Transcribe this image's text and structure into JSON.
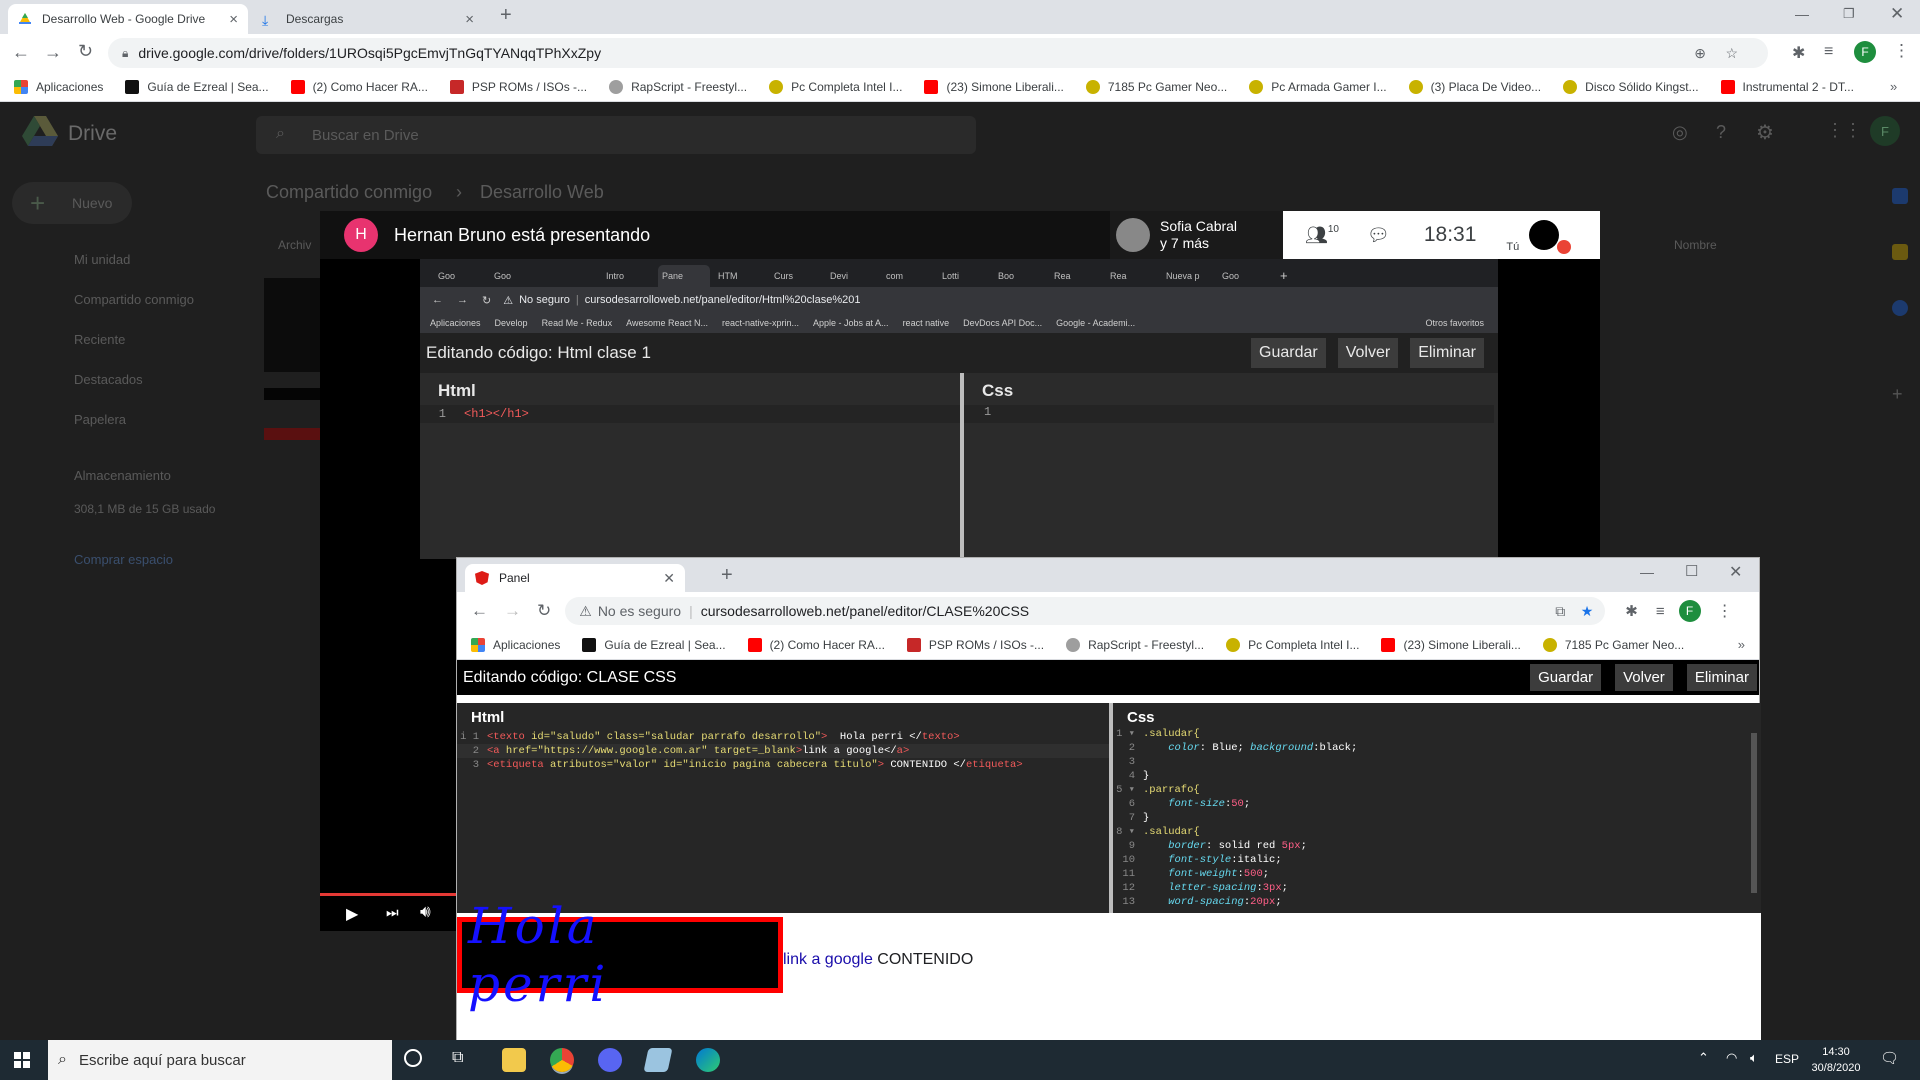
{
  "outer_tabs": [
    {
      "label": "Desarrollo Web - Google Drive"
    },
    {
      "label": "Descargas"
    }
  ],
  "outer_url": "drive.google.com/drive/folders/1UROsqi5PgcEmvjTnGqTYANqqTPhXxZpy",
  "outer_bookmarks": [
    {
      "label": "Aplicaciones",
      "color": "#ea4335"
    },
    {
      "label": "Guía de Ezreal | Sea...",
      "color": "#111111"
    },
    {
      "label": "(2) Como Hacer RA...",
      "color": "#ff0000"
    },
    {
      "label": "PSP ROMs / ISOs -...",
      "color": "#c62828"
    },
    {
      "label": "RapScript - Freestyl...",
      "color": "#9e9e9e"
    },
    {
      "label": "Pc Completa Intel I...",
      "color": "#c8b200"
    },
    {
      "label": "(23) Simone Liberali...",
      "color": "#ff0000"
    },
    {
      "label": "7185 Pc Gamer Neo...",
      "color": "#c8b200"
    },
    {
      "label": "Pc Armada Gamer I...",
      "color": "#c8b200"
    },
    {
      "label": "(3) Placa De Video...",
      "color": "#c8b200"
    },
    {
      "label": "Disco Sólido Kingst...",
      "color": "#c8b200"
    },
    {
      "label": "Instrumental 2 - DT...",
      "color": "#ff0000"
    }
  ],
  "drive": {
    "brand": "Drive",
    "search_placeholder": "Buscar en Drive",
    "new_label": "Nuevo",
    "breadcrumb_root": "Compartido conmigo",
    "breadcrumb_current": "Desarrollo Web",
    "nav": [
      "Mi unidad",
      "Compartido conmigo",
      "Reciente",
      "Destacados",
      "Papelera"
    ],
    "storage_label": "Almacenamiento",
    "storage_used": "308,1 MB de 15 GB usado",
    "buy_storage": "Comprar espacio",
    "col_archivo": "Archiv",
    "col_nombre": "Nombre"
  },
  "meet": {
    "presenter_initial": "H",
    "presenter_text": "Hernan Bruno está presentando",
    "participant_name": "Sofia Cabral",
    "participant_more": "y 7 más",
    "participants_count": "10",
    "time": "18:31",
    "self_label": "Tú"
  },
  "inner": {
    "tabs": [
      "Goo",
      "Goo",
      "",
      "Intro",
      "Pane",
      "HTM",
      "Curs",
      "Devi",
      "com",
      "Lotti",
      "Boo",
      "Rea",
      "Rea",
      "Nueva p",
      "Goo"
    ],
    "not_secure": "No seguro",
    "url": "cursodesarrolloweb.net/panel/editor/Html%20clase%201",
    "bookmarks": [
      "Aplicaciones",
      "Develop",
      "Read Me - Redux",
      "Awesome React N...",
      "react-native-xprin...",
      "Apple - Jobs at A...",
      "react native",
      "DevDocs API Doc...",
      "Google - Academi..."
    ],
    "other_bookmarks": "Otros favoritos",
    "editing_title": "Editando código: Html clase 1",
    "save": "Guardar",
    "back": "Volver",
    "delete": "Eliminar",
    "html_label": "Html",
    "css_label": "Css",
    "html_line": "<h1></h1>",
    "line_num": "1"
  },
  "popup": {
    "tab_title": "Panel",
    "not_secure": "No es seguro",
    "url": "cursodesarrolloweb.net/panel/editor/CLASE%20CSS",
    "bookmarks": [
      "Aplicaciones",
      "Guía de Ezreal | Sea...",
      "(2) Como Hacer RA...",
      "PSP ROMs / ISOs -...",
      "RapScript - Freestyl...",
      "Pc Completa Intel I...",
      "(23) Simone Liberali...",
      "7185 Pc Gamer Neo..."
    ],
    "editing_title": "Editando código: CLASE CSS",
    "save": "Guardar",
    "back": "Volver",
    "delete": "Eliminar",
    "html_label": "Html",
    "css_label": "Css",
    "preview_heading": "Hola  perri",
    "preview_link": "link a google",
    "preview_content": "CONTENIDO"
  },
  "taskbar": {
    "search_placeholder": "Escribe aquí para buscar",
    "lang": "ESP",
    "time": "14:30",
    "date": "30/8/2020"
  }
}
